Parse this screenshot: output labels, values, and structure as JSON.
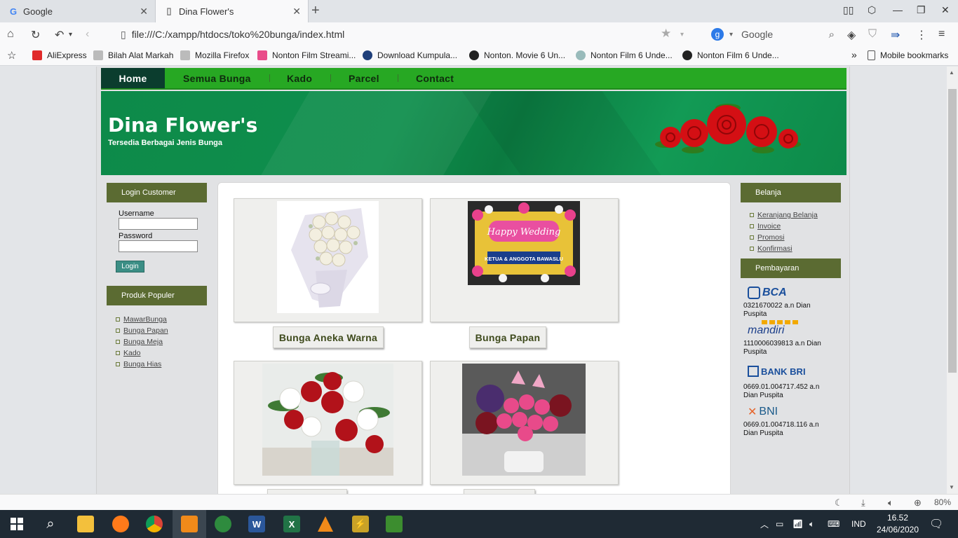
{
  "browser": {
    "tabs": [
      {
        "title": "Google",
        "active": false
      },
      {
        "title": "Dina Flower's",
        "active": true
      }
    ],
    "url": "file:///C:/xampp/htdocs/toko%20bunga/index.html",
    "search_engine": "Google",
    "bookmarks": [
      "AliExpress",
      "Bilah Alat Markah",
      "Mozilla Firefox",
      "Nonton Film Streami...",
      "Download Kumpula...",
      "Nonton. Movie 6 Un...",
      "Nonton Film 6 Unde...",
      "Nonton Film 6 Unde..."
    ],
    "overflow": "»",
    "mobile_bookmarks": "Mobile bookmarks",
    "zoom": "80%"
  },
  "site": {
    "menu": [
      "Home",
      "Semua Bunga",
      "Kado",
      "Parcel",
      "Contact"
    ],
    "title": "Dina Flower's",
    "subtitle": "Tersedia Berbagai Jenis Bunga",
    "login": {
      "heading": "Login Customer",
      "username_label": "Username",
      "password_label": "Password",
      "button": "Login"
    },
    "popular": {
      "heading": "Produk Populer",
      "items": [
        "MawarBunga",
        "Bunga Papan",
        "Bunga Meja",
        "Kado",
        "Bunga Hias"
      ]
    },
    "shop": {
      "heading": "Belanja",
      "items": [
        "Keranjang Belanja",
        "Invoice",
        "Promosi",
        "Konfirmasi"
      ]
    },
    "payment": {
      "heading": "Pembayaran",
      "banks": [
        {
          "name": "BCA",
          "account": "0321670022 a.n Dian Puspita",
          "color": "#1a4f9c"
        },
        {
          "name": "mandiri",
          "account": "1110006039813 a.n Dian Puspita",
          "color": "#1c3f8a"
        },
        {
          "name": "BANK BRI",
          "account": "0669.01.004717.452 a.n Dian Puspita",
          "color": "#1a4f9c"
        },
        {
          "name": "BNI",
          "account": "0669.01.004718.116 a.n Dian Puspita",
          "color": "#1a5a8a"
        }
      ]
    },
    "products": [
      {
        "label": "Bunga Aneka Warna"
      },
      {
        "label": "Bunga Papan"
      }
    ],
    "accent": "#27a823",
    "banner_color": "#0d8a49",
    "sidebar_head_color": "#5b6b32"
  },
  "system": {
    "language": "IND",
    "time": "16.52",
    "date": "24/06/2020"
  }
}
